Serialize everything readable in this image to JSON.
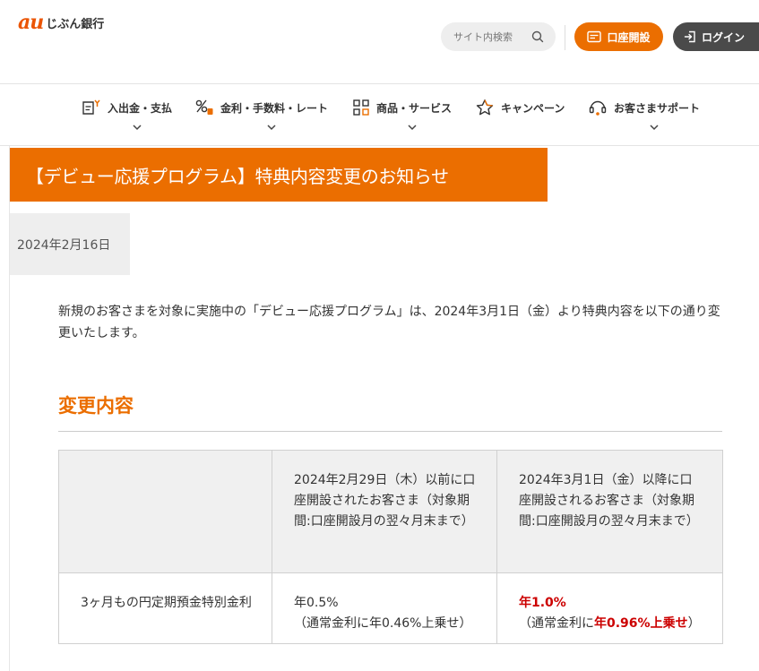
{
  "header": {
    "logo_mark": "au",
    "logo_text": "じぶん銀行",
    "search_placeholder": "サイト内検索",
    "open_account_label": "口座開設",
    "login_label": "ログイン"
  },
  "nav": [
    {
      "label": "入出金・支払",
      "icon": "deposit-withdraw-icon"
    },
    {
      "label": "金利・手数料・レート",
      "icon": "percent-icon"
    },
    {
      "label": "商品・サービス",
      "icon": "grid-icon"
    },
    {
      "label": "キャンペーン",
      "icon": "star-icon"
    },
    {
      "label": "お客さまサポート",
      "icon": "headset-icon"
    }
  ],
  "article": {
    "title": "【デビュー応援プログラム】特典内容変更のお知らせ",
    "date": "2024年2月16日",
    "intro": "新規のお客さまを対象に実施中の「デビュー応援プログラム」は、2024年3月1日（金）より特典内容を以下の通り変更いたします。",
    "section_title": "変更内容"
  },
  "table": {
    "head": {
      "col0": "",
      "col1": "2024年2月29日（木）以前に口座開設されたお客さま（対象期間:口座開設月の翌々月末まで）",
      "col2": "2024年3月1日（金）以降に口座開設されるお客さま（対象期間:口座開設月の翌々月末まで）"
    },
    "row1": {
      "label": "3ヶ月もの円定期預金特別金利",
      "before_rate": "年0.5%",
      "before_note": "（通常金利に年0.46%上乗せ）",
      "after_rate": "年1.0%",
      "after_note_pre": "（通常金利に",
      "after_note_em": "年0.96%上乗せ",
      "after_note_post": "）"
    }
  },
  "colors": {
    "brand_orange": "#eb6e00",
    "logo_orange": "#eb5505",
    "emphasis_red": "#cc0000",
    "login_dark": "#4a4a4a"
  }
}
